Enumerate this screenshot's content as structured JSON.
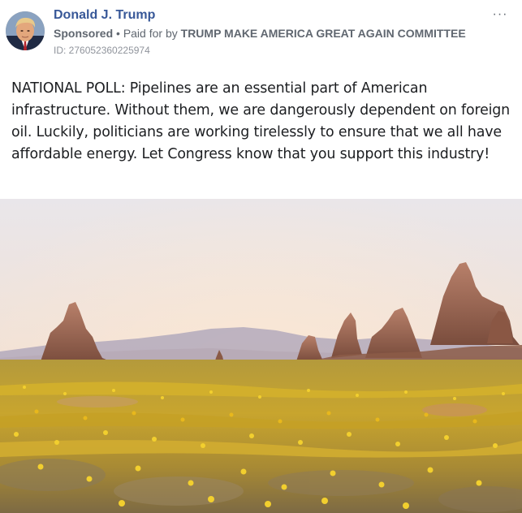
{
  "post": {
    "author": "Donald J. Trump",
    "sponsored_label": "Sponsored",
    "separator": "•",
    "paid_for_prefix": "Paid for by",
    "sponsor_name": "TRUMP MAKE AMERICA GREAT AGAIN COMMITTEE",
    "ad_id": "ID: 276052360225974",
    "more_icon": "more-options-icon",
    "more_glyph": "···",
    "text": "NATIONAL POLL: Pipelines are an essential part of American infrastructure. Without them, we are dangerously dependent on foreign oil. Luckily, politicians are working tirelessly to ensure that we all have affordable energy. Let Congress know that you support this industry!"
  },
  "colors": {
    "author_link": "#385898",
    "secondary_text": "#606770",
    "body_text": "#1c1e21"
  }
}
